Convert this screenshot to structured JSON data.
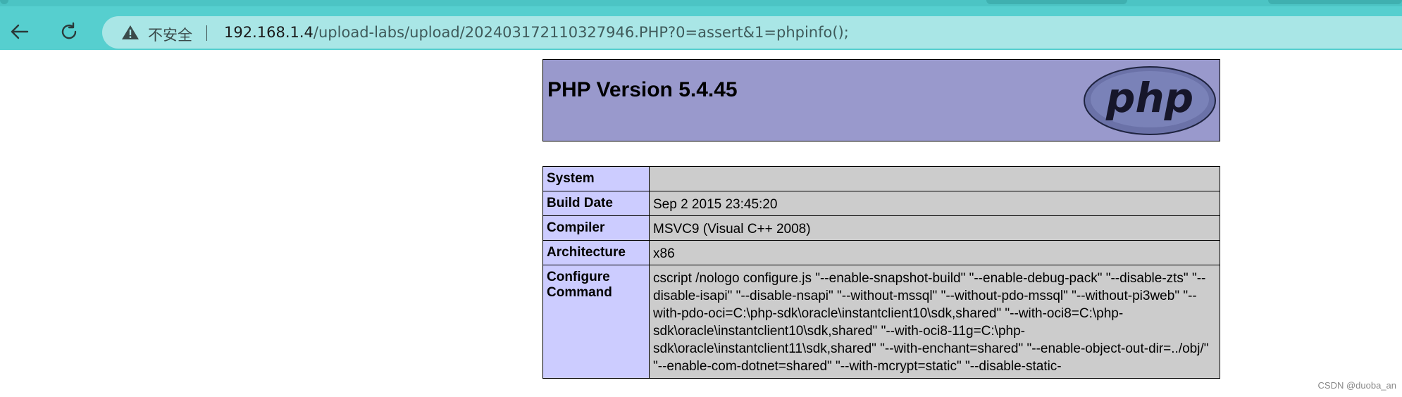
{
  "browser": {
    "security_label": "不安全",
    "url_host": "192.168.1.4",
    "url_path": "/upload-labs/upload/202403172110327946.PHP?0=assert&1=phpinfo();",
    "icons": [
      "back-arrow-icon",
      "reload-icon",
      "warning-triangle-icon"
    ]
  },
  "php": {
    "title": "PHP Version 5.4.45",
    "logo_text": "php",
    "rows": [
      {
        "key": "System",
        "value": ""
      },
      {
        "key": "Build Date",
        "value": "Sep 2 2015 23:45:20"
      },
      {
        "key": "Compiler",
        "value": "MSVC9 (Visual C++ 2008)"
      },
      {
        "key": "Architecture",
        "value": "x86"
      },
      {
        "key": "Configure Command",
        "value": "cscript /nologo configure.js \"--enable-snapshot-build\" \"--enable-debug-pack\" \"--disable-zts\" \"--disable-isapi\" \"--disable-nsapi\" \"--without-mssql\" \"--without-pdo-mssql\" \"--without-pi3web\" \"--with-pdo-oci=C:\\php-sdk\\oracle\\instantclient10\\sdk,shared\" \"--with-oci8=C:\\php-sdk\\oracle\\instantclient10\\sdk,shared\" \"--with-oci8-11g=C:\\php-sdk\\oracle\\instantclient11\\sdk,shared\" \"--with-enchant=shared\" \"--enable-object-out-dir=../obj/\" \"--enable-com-dotnet=shared\" \"--with-mcrypt=static\" \"--disable-static-"
      }
    ]
  },
  "watermark": "CSDN @duoba_an",
  "colors": {
    "toolbar": "#56cfcf",
    "omnibox": "#a9e6e6",
    "php_header": "#9999cc",
    "key_cell": "#ccccff",
    "value_cell": "#cccccc"
  }
}
